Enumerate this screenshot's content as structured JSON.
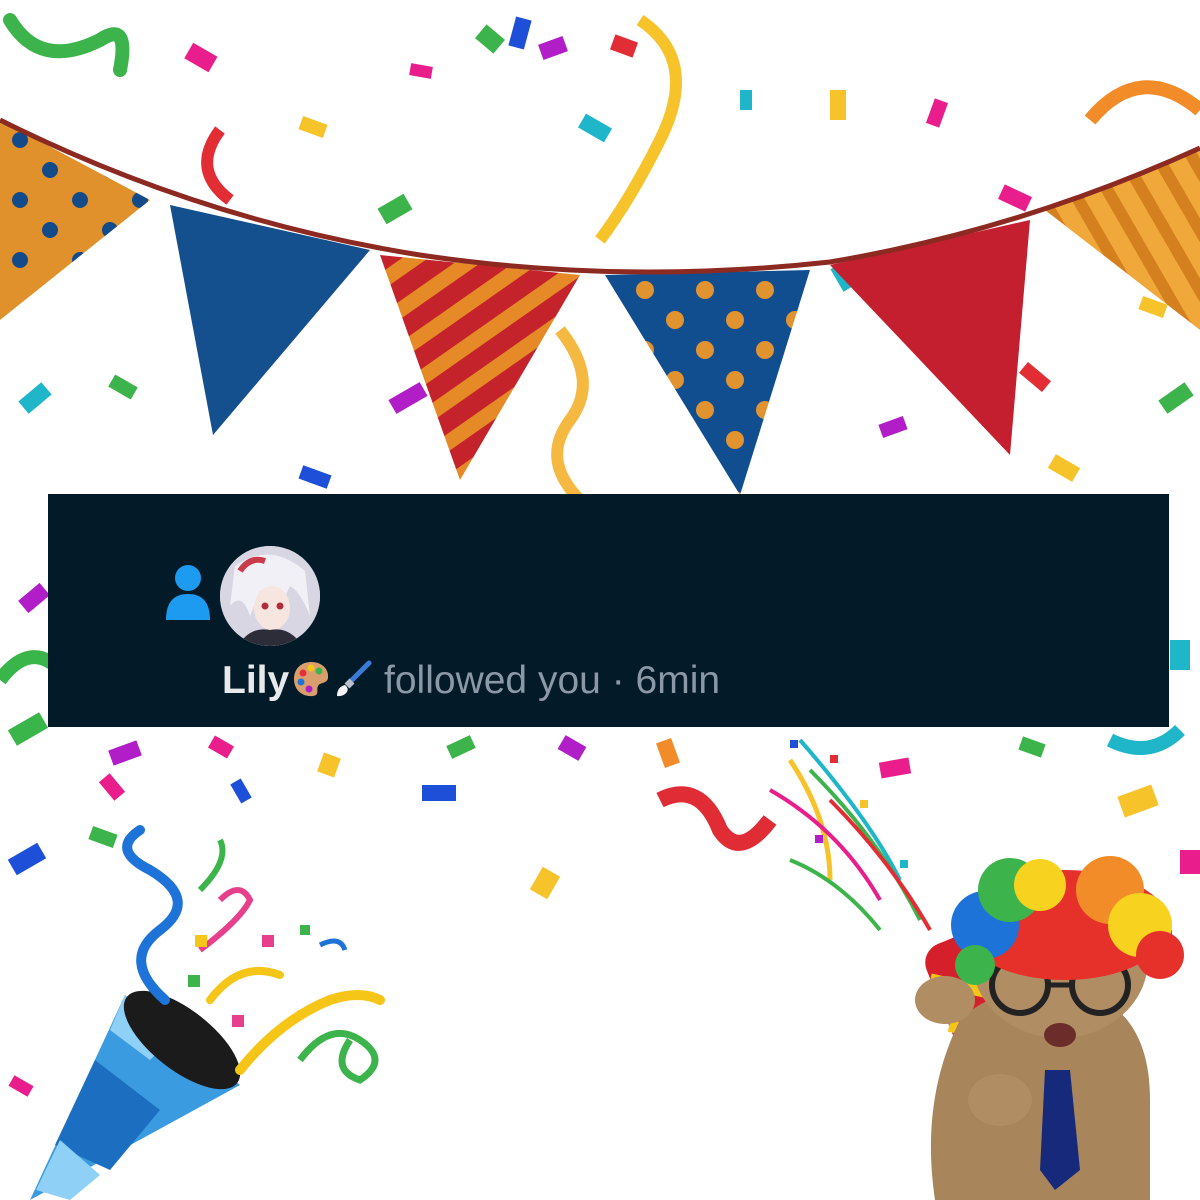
{
  "notification": {
    "type_icon": "person-icon",
    "avatar": "user-avatar-anime-character",
    "username": "Lily",
    "username_emoji": [
      "artist-palette-icon",
      "paintbrush-icon"
    ],
    "action": "followed you",
    "separator": "·",
    "time": "6min"
  },
  "decorations": {
    "bunting": "pennant-banner",
    "confetti": "confetti-streamers",
    "party_popper": "party-popper-icon",
    "cat": "clown-cat-with-popper"
  },
  "colors": {
    "card_bg": "#031a29",
    "icon_blue": "#1d9bf0",
    "name_text": "#e7e9ea",
    "muted_text": "#8b98a5"
  }
}
